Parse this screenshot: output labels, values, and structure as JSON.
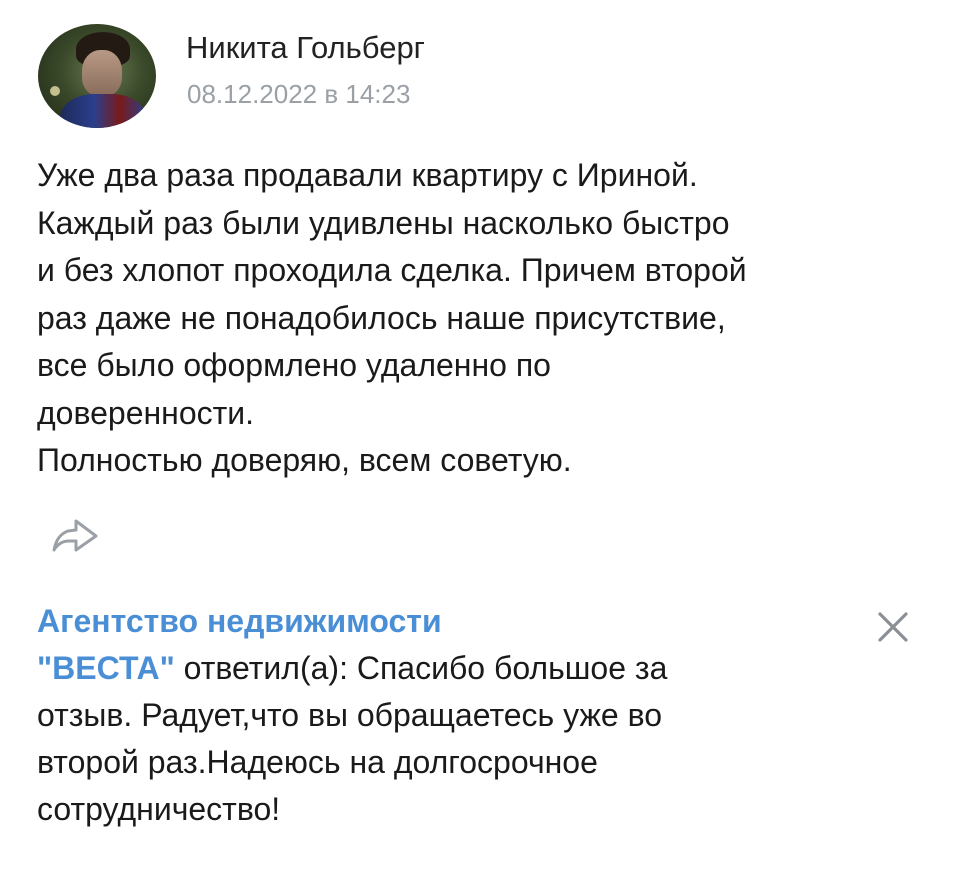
{
  "post": {
    "author": "Никита Гольберг",
    "date": "08.12.2022 в 14:23",
    "text_lines": [
      "Уже два раза продавали квартиру с Ириной.",
      "Каждый раз были удивлены насколько быстро",
      "и без хлопот проходила сделка. Причем второй",
      "раз даже не понадобилось наше присутствие,",
      "все было оформлено удаленно по",
      "доверенности.",
      "Полностью доверяю, всем советую."
    ],
    "share_icon": "share-arrow-icon"
  },
  "reply": {
    "agency_line1": "Агентство недвижимости",
    "agency_line2": "\"ВЕСТА\"",
    "verb": " ответил(а): Спасибо большое за",
    "text_lines": [
      "отзыв. Радует,что вы обращаетесь уже во",
      "второй раз.Надеюсь на долгосрочное",
      "сотрудничество!"
    ],
    "close_icon": "close-icon"
  },
  "colors": {
    "accent": "#4a8fd6",
    "muted": "#9aa0a6",
    "text": "#1a1a1a"
  }
}
